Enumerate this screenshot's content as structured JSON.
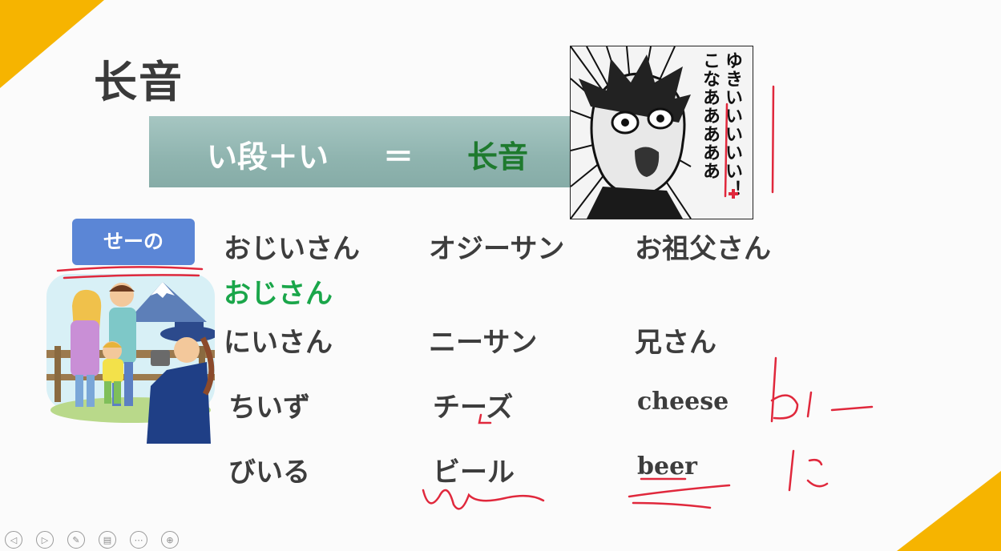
{
  "slide": {
    "title": "长音",
    "banner": {
      "left": "い段＋い",
      "equals": "＝",
      "right": "长音"
    },
    "manga_text": {
      "line1": "こなあああああ",
      "line2": "ゆきいいいいい！"
    },
    "say_button": "せーの",
    "rows": [
      {
        "hiragana": "おじいさん",
        "katakana": "オジーサン",
        "kanji": "お祖父さん"
      },
      {
        "hiragana": "おじさん"
      },
      {
        "hiragana": "にいさん",
        "katakana": "ニーサン",
        "kanji": "兄さん"
      },
      {
        "hiragana": "ちいず",
        "katakana": "チーズ",
        "english": "cheese"
      },
      {
        "hiragana": "びいる",
        "katakana": "ビール",
        "english": "beer"
      }
    ]
  },
  "controls": [
    {
      "icon": "prev-icon",
      "glyph": "◁"
    },
    {
      "icon": "next-icon",
      "glyph": "▷"
    },
    {
      "icon": "pen-icon",
      "glyph": "✎"
    },
    {
      "icon": "slides-icon",
      "glyph": "▤"
    },
    {
      "icon": "more-icon",
      "glyph": "⋯"
    },
    {
      "icon": "zoom-icon",
      "glyph": "⊕"
    }
  ],
  "colors": {
    "accent": "#f6b400",
    "button": "#5b86d6",
    "green": "#1aa64a",
    "banner": "#8fb4af",
    "ink": "#e0283c"
  }
}
